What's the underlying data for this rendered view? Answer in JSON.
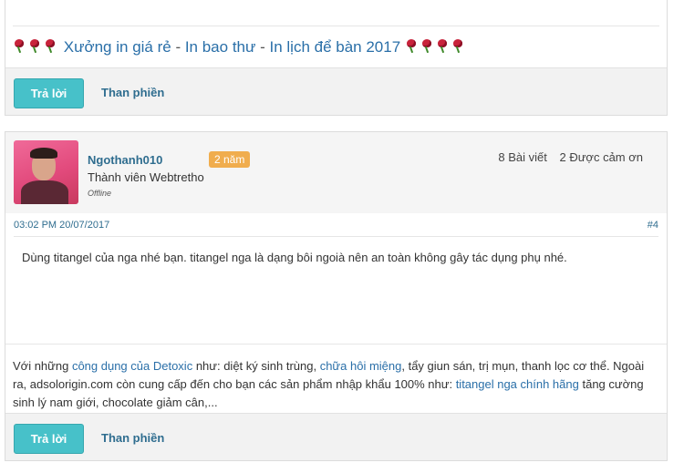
{
  "post_prev": {
    "signature_links": [
      {
        "text": "Xưởng in giá rẻ"
      },
      {
        "text": "In bao thư"
      },
      {
        "text": "In lịch để bàn 2017"
      }
    ],
    "separator": " - ",
    "reply_label": "Trả lời",
    "thanks_label": "Than phiền"
  },
  "post": {
    "username": "Ngothanh010",
    "badge": "2 năm",
    "user_title": "Thành viên Webtretho",
    "status": "Offline",
    "post_count": "8 Bài viết",
    "thanks_count": "2 Được cảm ơn",
    "timestamp": "03:02 PM 20/07/2017",
    "post_number": "#4",
    "content": "Dùng titangel của nga nhé bạn. titangel nga là dạng bôi ngoià nên an toàn không gây tác dụng phụ nhé.",
    "signature": {
      "t1": "Với những ",
      "l1": "công dụng của Detoxic",
      "t2": " như: diệt ký sinh trùng, ",
      "l2": "chữa hôi miệng",
      "t3": ", tẩy giun sán, trị mụn, thanh lọc cơ thể. Ngoài ra, adsolorigin.com còn cung cấp đến cho bạn các sản phẩm nhập khẩu 100% như: ",
      "l3": "titangel nga chính hãng",
      "t4": " tăng cường sinh lý nam giới, chocolate giảm cân,..."
    },
    "reply_label": "Trả lời",
    "thanks_label": "Than phiền"
  },
  "colors": {
    "link": "#2a6fa8",
    "reply_button": "#47c1c9",
    "badge": "#f0ad4e",
    "username": "#2f6d8f"
  },
  "icons": [
    "rose-icon"
  ]
}
